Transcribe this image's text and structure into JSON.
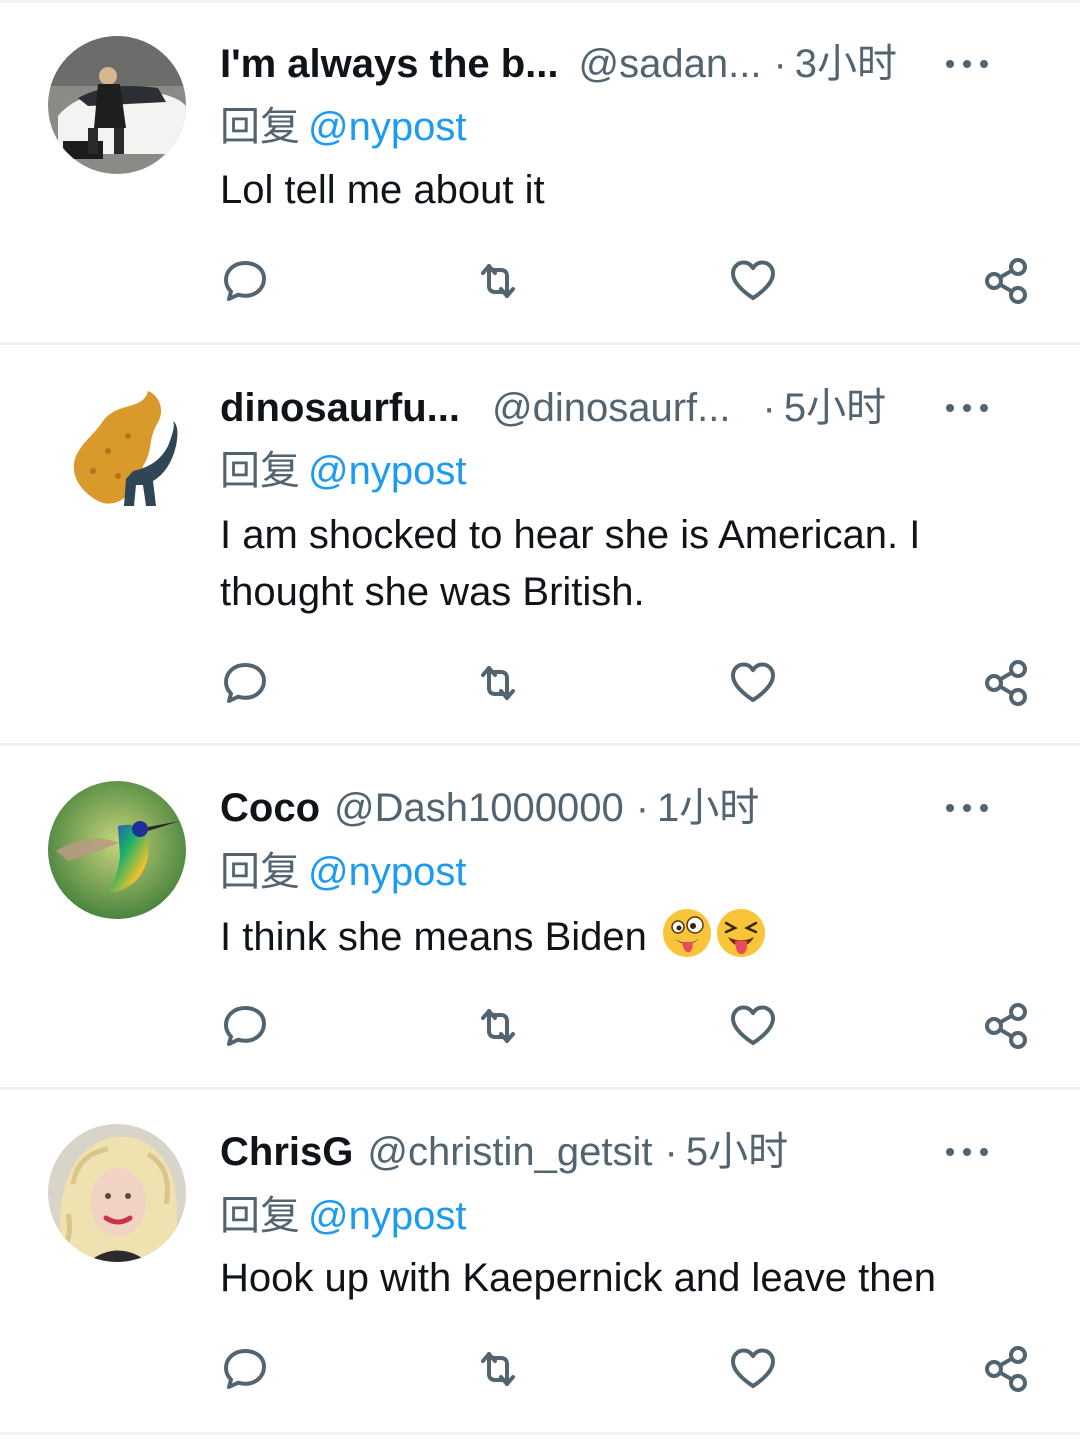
{
  "tweets": [
    {
      "name": "I'm always the b...",
      "handle": "@sadan...",
      "dot": "·",
      "time": "3小时",
      "reply_label": "回复",
      "mention": "@nypost",
      "text": "Lol tell me about it",
      "avatar_icon": "avatar-car-person"
    },
    {
      "name": "dinosaurfu...",
      "handle": "@dinosaurf...",
      "dot": "·",
      "time": "5小时",
      "reply_label": "回复",
      "mention": "@nypost",
      "text": "I am shocked to hear she is American. I thought she was British.",
      "avatar_icon": "avatar-dino-nugget"
    },
    {
      "name": "Coco",
      "handle": "@Dash1000000",
      "dot": "·",
      "time": "1小时",
      "reply_label": "回复",
      "mention": "@nypost",
      "text": "I think she means Biden",
      "emojis": [
        "zany-face-emoji",
        "squinting-tongue-face-emoji"
      ],
      "avatar_icon": "avatar-hummingbird"
    },
    {
      "name": "ChrisG",
      "handle": "@christin_getsit",
      "dot": "·",
      "time": "5小时",
      "reply_label": "回复",
      "mention": "@nypost",
      "text": "Hook up with Kaepernick and leave then",
      "avatar_icon": "avatar-blonde-woman"
    }
  ],
  "colors": {
    "text_primary": "#0f1419",
    "text_secondary": "#536471",
    "link": "#1d9bf0",
    "divider": "#eff3f4"
  },
  "action_icons": [
    "reply-icon",
    "retweet-icon",
    "like-icon",
    "share-icon"
  ]
}
